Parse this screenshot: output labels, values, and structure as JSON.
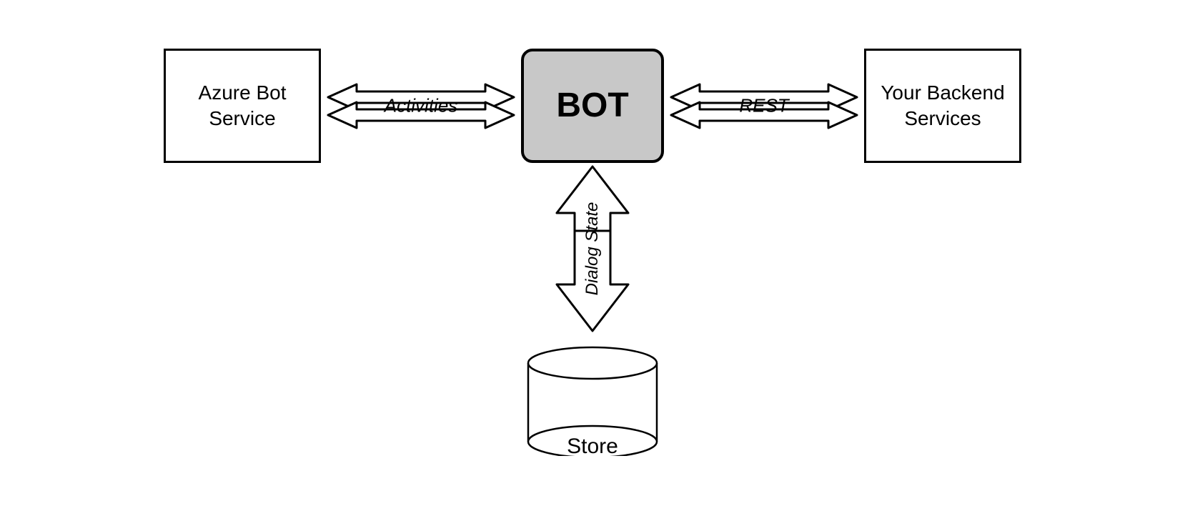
{
  "diagram": {
    "azure_box_label": "Azure Bot Service",
    "bot_box_label": "BOT",
    "backend_box_label": "Your Backend Services",
    "activities_label": "Activities",
    "rest_label": "REST",
    "dialog_state_label": "Dialog State",
    "store_label": "Store"
  }
}
